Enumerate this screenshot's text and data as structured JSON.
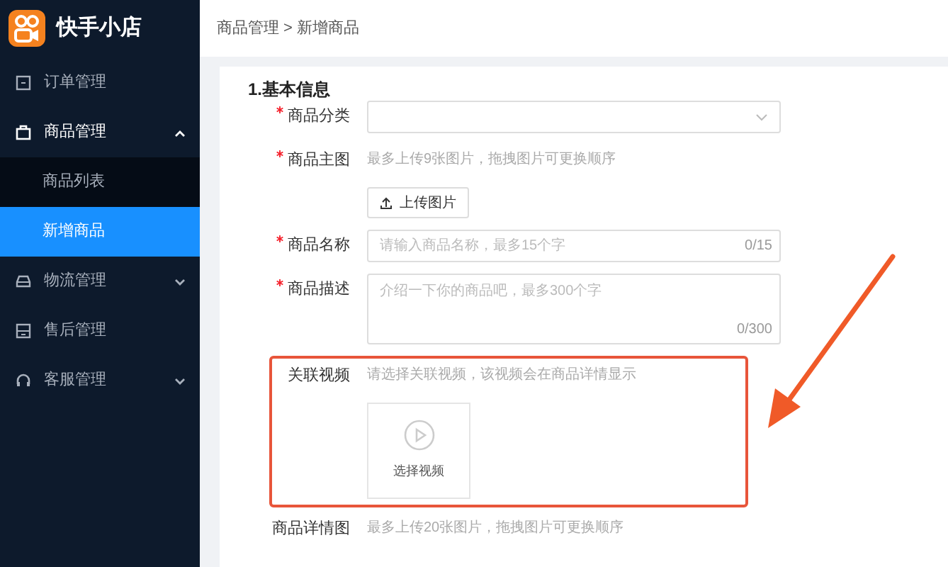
{
  "logo": {
    "title": "快手小店"
  },
  "sidebar": {
    "items": [
      {
        "label": "订单管理",
        "kind": "order"
      },
      {
        "label": "商品管理",
        "kind": "bag",
        "expanded": true,
        "children": [
          {
            "label": "商品列表",
            "selected": false
          },
          {
            "label": "新增商品",
            "selected": true
          }
        ]
      },
      {
        "label": "物流管理",
        "kind": "car",
        "expanded": false
      },
      {
        "label": "售后管理",
        "kind": "service"
      },
      {
        "label": "客服管理",
        "kind": "headset",
        "expanded": false
      }
    ]
  },
  "breadcrumb": "商品管理 > 新增商品",
  "form": {
    "section_title": "1.基本信息",
    "fields": [
      {
        "kind": "select",
        "label": "商品分类",
        "required": true
      },
      {
        "kind": "image_upload",
        "label": "商品主图",
        "required": true,
        "hint": "最多上传9张图片，拖拽图片可更换顺序",
        "button": "上传图片"
      },
      {
        "kind": "text",
        "label": "商品名称",
        "required": true,
        "placeholder": "请输入商品名称，最多15个字",
        "counter": "0/15"
      },
      {
        "kind": "textarea",
        "label": "商品描述",
        "required": true,
        "placeholder": "介绍一下你的商品吧，最多300个字",
        "counter": "0/300"
      },
      {
        "kind": "video",
        "label": "关联视频",
        "required": false,
        "hint": "请选择关联视频，该视频会在商品详情显示",
        "button": "选择视频",
        "highlighted": true
      },
      {
        "kind": "hint_only",
        "label": "商品详情图",
        "required": false,
        "hint": "最多上传20张图片，拖拽图片可更换顺序"
      }
    ]
  }
}
